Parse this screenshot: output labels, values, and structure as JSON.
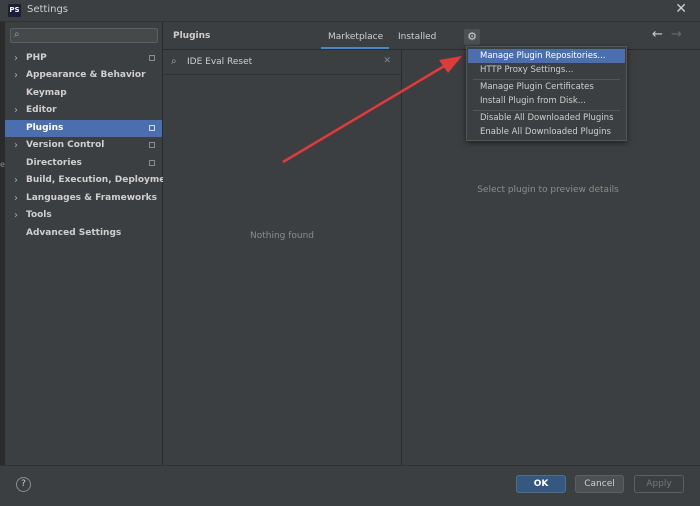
{
  "window": {
    "app_icon_text": "PS",
    "title": "Settings",
    "close_glyph": "✕"
  },
  "sidebar": {
    "search": {
      "value": "",
      "placeholder": ""
    },
    "items": [
      {
        "label": "PHP",
        "has_chevron": true,
        "project_icon": true,
        "selected": false
      },
      {
        "label": "Appearance & Behavior",
        "has_chevron": true,
        "project_icon": false,
        "selected": false
      },
      {
        "label": "Keymap",
        "has_chevron": false,
        "project_icon": false,
        "selected": false
      },
      {
        "label": "Editor",
        "has_chevron": true,
        "project_icon": false,
        "selected": false
      },
      {
        "label": "Plugins",
        "has_chevron": false,
        "project_icon": true,
        "selected": true
      },
      {
        "label": "Version Control",
        "has_chevron": true,
        "project_icon": true,
        "selected": false
      },
      {
        "label": "Directories",
        "has_chevron": false,
        "project_icon": true,
        "selected": false
      },
      {
        "label": "Build, Execution, Deployment",
        "has_chevron": true,
        "project_icon": false,
        "selected": false
      },
      {
        "label": "Languages & Frameworks",
        "has_chevron": true,
        "project_icon": false,
        "selected": false
      },
      {
        "label": "Tools",
        "has_chevron": true,
        "project_icon": false,
        "selected": false
      },
      {
        "label": "Advanced Settings",
        "has_chevron": false,
        "project_icon": false,
        "selected": false
      }
    ]
  },
  "plugins": {
    "title": "Plugins",
    "tabs": [
      {
        "label": "Marketplace",
        "active": true
      },
      {
        "label": "Installed",
        "active": false
      }
    ],
    "search_value": "IDE Eval Reset",
    "empty_text": "Nothing found",
    "detail_placeholder": "Select plugin to preview details",
    "back_arrow": "←",
    "forward_arrow": "→"
  },
  "settings_menu": {
    "groups": [
      [
        {
          "label": "Manage Plugin Repositories...",
          "highlighted": true
        },
        {
          "label": "HTTP Proxy Settings...",
          "highlighted": false
        }
      ],
      [
        {
          "label": "Manage Plugin Certificates",
          "highlighted": false
        },
        {
          "label": "Install Plugin from Disk...",
          "highlighted": false
        }
      ],
      [
        {
          "label": "Disable All Downloaded Plugins",
          "highlighted": false
        },
        {
          "label": "Enable All Downloaded Plugins",
          "highlighted": false
        }
      ]
    ]
  },
  "footer": {
    "help_glyph": "?",
    "ok_label": "OK",
    "cancel_label": "Cancel",
    "apply_label": "Apply"
  },
  "colors": {
    "selection": "#4b6eaf",
    "annotation_arrow": "#e03a3a",
    "primary_button": "#365880"
  }
}
